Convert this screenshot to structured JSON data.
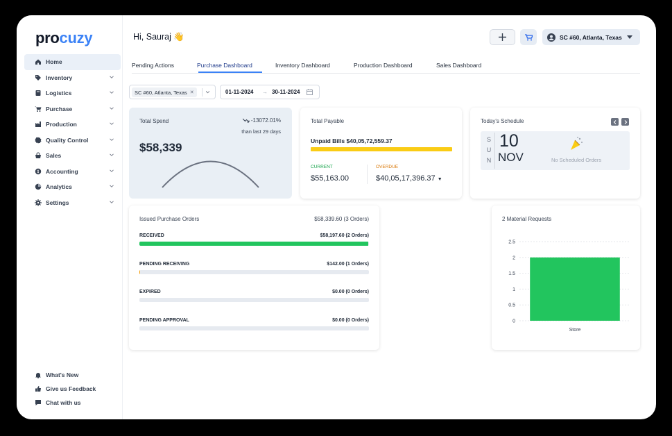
{
  "app": {
    "logo_main": "pro",
    "logo_accent": "cuzy"
  },
  "sidebar": {
    "items": [
      {
        "label": "Home",
        "icon": "home-icon",
        "active": true
      },
      {
        "label": "Inventory",
        "icon": "tag-icon"
      },
      {
        "label": "Logistics",
        "icon": "box-icon"
      },
      {
        "label": "Purchase",
        "icon": "cart-icon"
      },
      {
        "label": "Production",
        "icon": "factory-icon"
      },
      {
        "label": "Quality Control",
        "icon": "quality-icon"
      },
      {
        "label": "Sales",
        "icon": "sales-icon"
      },
      {
        "label": "Accounting",
        "icon": "accounting-icon"
      },
      {
        "label": "Analytics",
        "icon": "analytics-icon"
      },
      {
        "label": "Settings",
        "icon": "gear-icon"
      }
    ],
    "bottom": [
      {
        "label": "What's New",
        "icon": "bell-icon"
      },
      {
        "label": "Give us Feedback",
        "icon": "thumbs-up-icon"
      },
      {
        "label": "Chat with us",
        "icon": "chat-icon"
      }
    ]
  },
  "header": {
    "greeting": "Hi, Sauraj 👋",
    "location": "SC #60, Atlanta, Texas"
  },
  "tabs": [
    "Pending Actions",
    "Purchase Dashboard",
    "Inventory Dashboard",
    "Production Dashboard",
    "Sales Dashboard"
  ],
  "filters": {
    "location_chip": "SC #60, Atlanta, Texas",
    "date_from": "01-11-2024",
    "date_to": "30-11-2024"
  },
  "total_spend": {
    "title": "Total Spend",
    "value": "$58,339",
    "change": "-13072.01%",
    "since": "than last 29 days"
  },
  "total_payable": {
    "title": "Total Payable",
    "unpaid": "Unpaid Bills $40,05,72,559.37",
    "current_label": "CURRENT",
    "current_value": "$55,163.00",
    "overdue_label": "OVERDUE",
    "overdue_value": "$40,05,17,396.37"
  },
  "schedule": {
    "title": "Today's Schedule",
    "weekday": [
      "S",
      "U",
      "N"
    ],
    "day": "10",
    "month": "NOV",
    "empty": "No Scheduled Orders"
  },
  "issued_po": {
    "title": "Issued Purchase Orders",
    "total": "$58,339.60 (3 Orders)",
    "rows": [
      {
        "label": "RECEIVED",
        "value": "$58,197.60 (2 Orders)",
        "progress": 0.998,
        "color": "#22c55e"
      },
      {
        "label": "PENDING RECEIVING",
        "value": "$142.00 (1 Orders)",
        "progress": 0.003,
        "color": "#f59e0b"
      },
      {
        "label": "EXPIRED",
        "value": "$0.00 (0 Orders)",
        "progress": 0,
        "color": "#22c55e"
      },
      {
        "label": "PENDING APPROVAL",
        "value": "$0.00 (0 Orders)",
        "progress": 0,
        "color": "#22c55e"
      }
    ]
  },
  "chart_data": {
    "type": "bar",
    "title": "2 Material Requests",
    "categories": [
      "Store"
    ],
    "values": [
      2
    ],
    "ylim": [
      0,
      2.5
    ],
    "yticks": [
      "0",
      "0.5",
      "1",
      "1.5",
      "2",
      "2.5"
    ],
    "color": "#22c55e",
    "grid": true
  }
}
